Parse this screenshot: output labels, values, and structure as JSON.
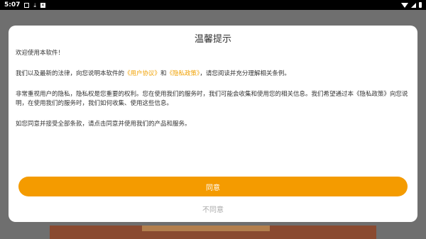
{
  "status_bar": {
    "time": "5:07"
  },
  "dialog": {
    "title": "温馨提示",
    "welcome": "欢迎使用本软件！",
    "law_prefix": "我们以及最新的法律，向您说明本软件的",
    "user_agreement_link": "《用户协议》",
    "and": "和",
    "privacy_policy_link": "《隐私政策》",
    "law_suffix": "，请您阅读并充分理解相关条例。",
    "privacy_text": "非常重视用户的隐私，隐私权是您重要的权利。您在使用我们的服务时，我们可能会收集和使用您的相关信息。我们希望通过本《隐私政策》向您说明，在使用我们的服务时，我们如何收集、使用这些信息。",
    "consent_text": "如您同意并接受全部条款，请点击同意并使用我们的产品和服务。",
    "agree_label": "同意",
    "disagree_label": "不同意"
  },
  "colors": {
    "accent": "#f49b00",
    "link": "#f0a000",
    "overlay": "#6f6f6f"
  }
}
